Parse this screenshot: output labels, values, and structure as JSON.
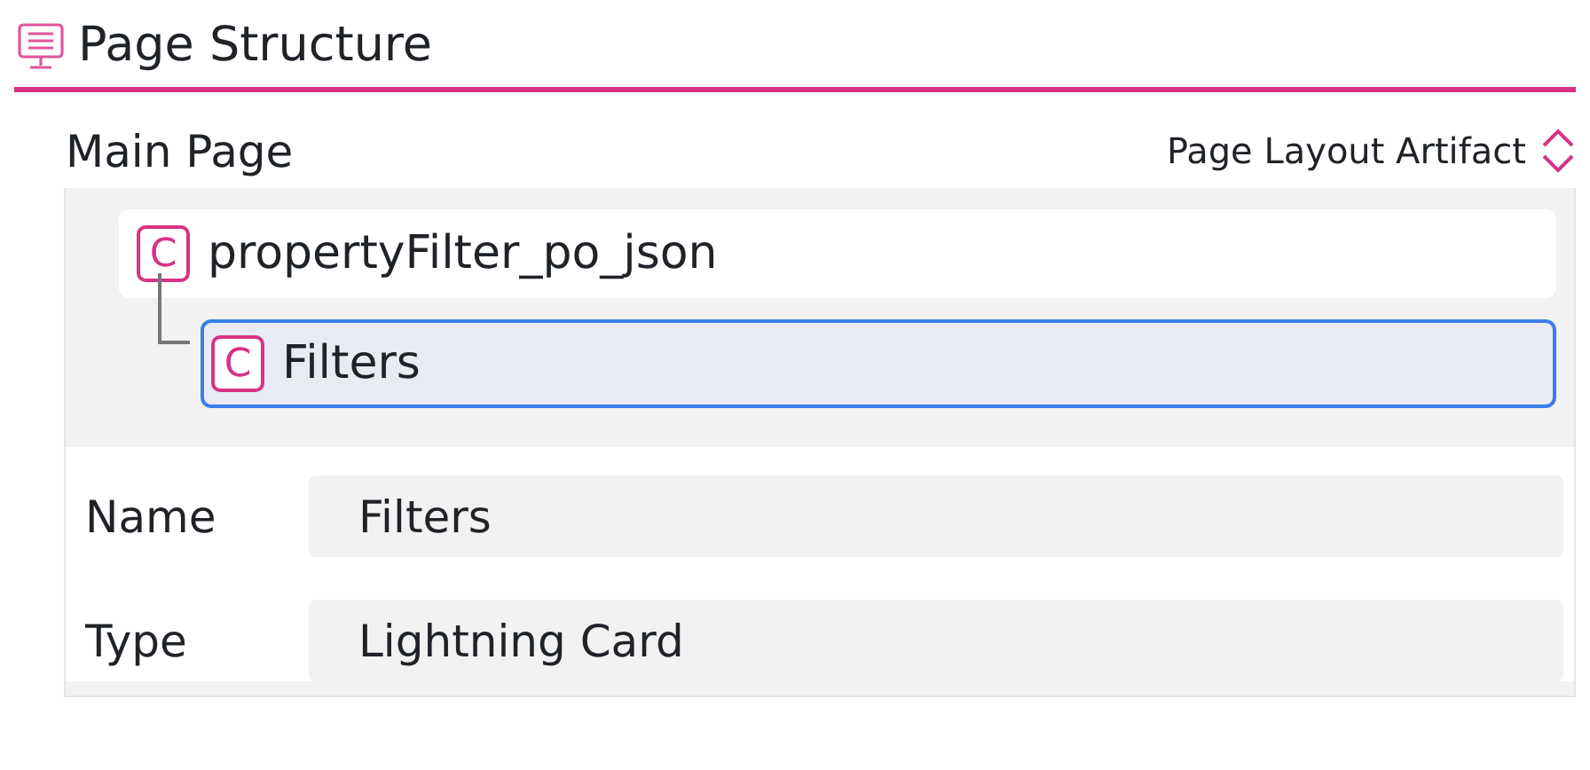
{
  "header": {
    "title": "Page Structure"
  },
  "page": {
    "name": "Main Page",
    "artifact_type": "Page Layout Artifact"
  },
  "tree": [
    {
      "badge": "C",
      "label": "propertyFilter_po_json",
      "selected": false,
      "children": [
        {
          "badge": "C",
          "label": "Filters",
          "selected": true
        }
      ]
    }
  ],
  "properties": [
    {
      "label": "Name",
      "value": "Filters"
    },
    {
      "label": "Type",
      "value": "Lightning Card"
    }
  ]
}
